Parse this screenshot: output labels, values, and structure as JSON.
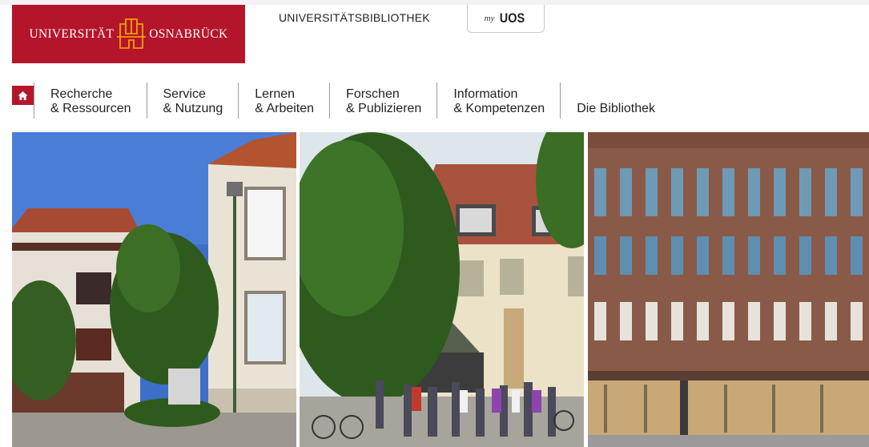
{
  "header": {
    "logo_left": "UNIVERSITÄT",
    "logo_right": "OSNABRÜCK",
    "library_title": "UNIVERSITÄTSBIBLIOTHEK",
    "myuos_prefix": "my",
    "myuos_label": "UOS"
  },
  "nav": {
    "home_icon": "home-icon",
    "items": [
      {
        "line1": "Recherche",
        "line2": "& Ressourcen"
      },
      {
        "line1": "Service",
        "line2": "& Nutzung"
      },
      {
        "line1": "Lernen",
        "line2": "& Arbeiten"
      },
      {
        "line1": "Forschen",
        "line2": "& Publizieren"
      },
      {
        "line1": "Information",
        "line2": "& Kompetenzen"
      },
      {
        "line1": "Die Bibliothek"
      }
    ]
  },
  "colors": {
    "brand": "#b5152b",
    "text": "#222222",
    "divider": "#9a9a9a"
  },
  "photos": [
    {
      "name": "library-building-photo"
    },
    {
      "name": "library-entrance-students-photo"
    },
    {
      "name": "brick-facade-building-photo"
    }
  ]
}
